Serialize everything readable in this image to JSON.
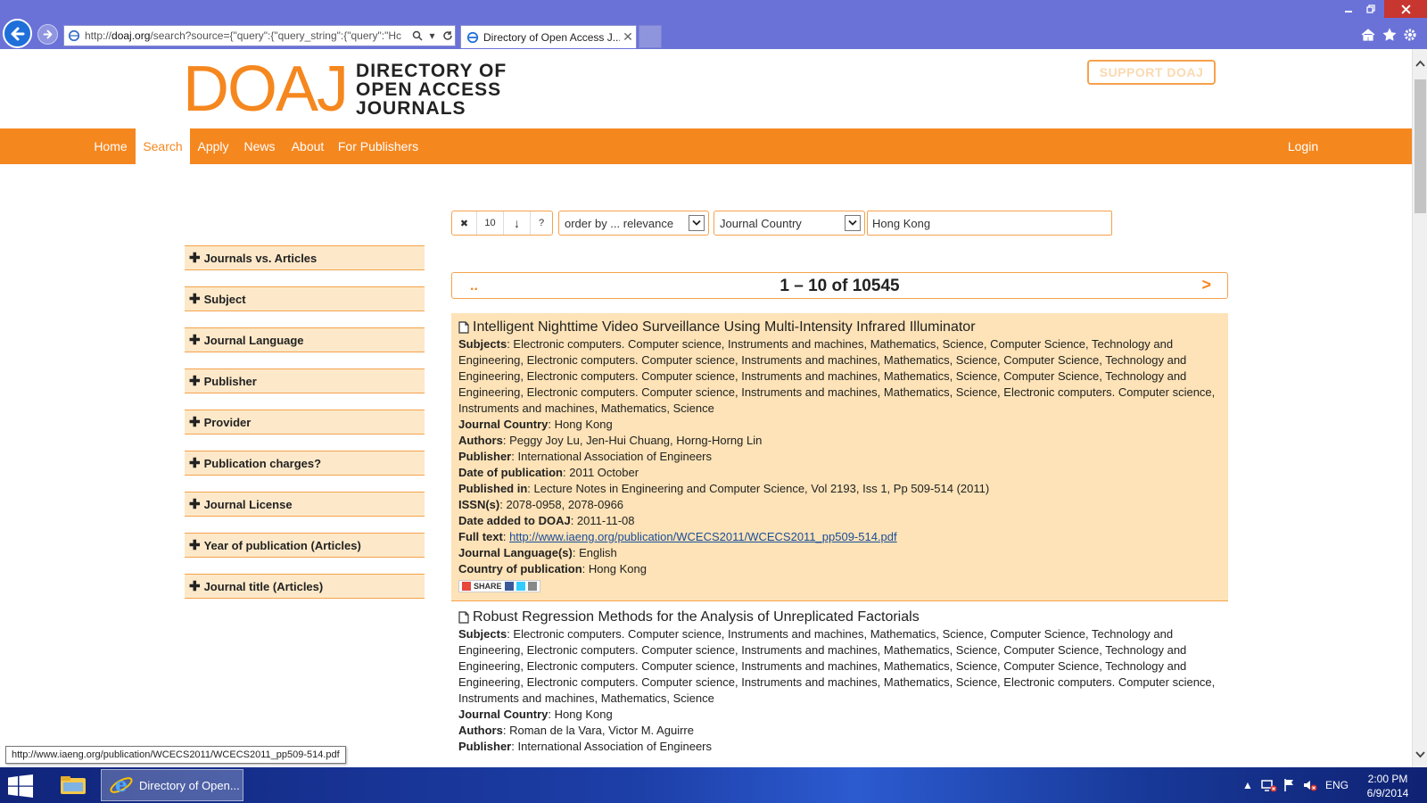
{
  "browser": {
    "address_host": "doaj.org",
    "address_prefix": "http://",
    "address_rest": "/search?source={\"query\":{\"query_string\":{\"query\":\"Hc",
    "tab_title": "Directory of Open Access J...",
    "tab_close": "✕"
  },
  "header": {
    "logo_mark": "DOAJ",
    "logo_line1": "DIRECTORY OF",
    "logo_line2": "OPEN ACCESS",
    "logo_line3": "JOURNALS",
    "support_label": "SUPPORT DOAJ"
  },
  "menu": {
    "items": [
      "Home",
      "Search",
      "Apply",
      "News",
      "About",
      "For Publishers"
    ],
    "active": "Search",
    "login": "Login"
  },
  "controls": {
    "clear": "✖",
    "page_size": "10",
    "sort_dir": "↓",
    "help": "?",
    "order_value": "order by ... relevance",
    "field_value": "Journal Country",
    "query_value": "Hong Kong"
  },
  "facets": [
    "Journals vs. Articles",
    "Subject",
    "Journal Language",
    "Publisher",
    "Provider",
    "Publication charges?",
    "Journal License",
    "Year of publication (Articles)",
    "Journal title (Articles)"
  ],
  "pager": {
    "prev": "..",
    "count": "1 – 10 of 10545",
    "next": ">"
  },
  "labels": {
    "subjects": "Subjects",
    "journal_country": "Journal Country",
    "authors": "Authors",
    "publisher": "Publisher",
    "date_pub": "Date of publication",
    "published_in": "Published in",
    "issn": "ISSN(s)",
    "date_added": "Date added to DOAJ",
    "full_text": "Full text",
    "journal_language": "Journal Language(s)",
    "country_pub": "Country of publication",
    "share": "SHARE"
  },
  "results": [
    {
      "title": "Intelligent Nighttime Video Surveillance Using Multi-Intensity Infrared Illuminator",
      "subjects": "Electronic computers. Computer science, Instruments and machines, Mathematics, Science, Computer Science, Technology and Engineering, Electronic computers. Computer science, Instruments and machines, Mathematics, Science, Computer Science, Technology and Engineering, Electronic computers. Computer science, Instruments and machines, Mathematics, Science, Computer Science, Technology and Engineering, Electronic computers. Computer science, Instruments and machines, Mathematics, Science, Electronic computers. Computer science, Instruments and machines, Mathematics, Science",
      "journal_country": "Hong Kong",
      "authors": "Peggy Joy Lu, Jen-Hui Chuang, Horng-Horng Lin",
      "publisher": "International Association of Engineers",
      "date_pub": "2011 October",
      "published_in": "Lecture Notes in Engineering and Computer Science, Vol 2193, Iss 1, Pp 509-514 (2011)",
      "issn": "2078-0958, 2078-0966",
      "date_added": "2011-11-08",
      "full_text": "http://www.iaeng.org/publication/WCECS2011/WCECS2011_pp509-514.pdf",
      "journal_language": "English",
      "country_pub": "Hong Kong"
    },
    {
      "title": "Robust Regression Methods for the Analysis of Unreplicated Factorials",
      "subjects": "Electronic computers. Computer science, Instruments and machines, Mathematics, Science, Computer Science, Technology and Engineering, Electronic computers. Computer science, Instruments and machines, Mathematics, Science, Computer Science, Technology and Engineering, Electronic computers. Computer science, Instruments and machines, Mathematics, Science, Computer Science, Technology and Engineering, Electronic computers. Computer science, Instruments and machines, Mathematics, Science, Electronic computers. Computer science, Instruments and machines, Mathematics, Science",
      "journal_country": "Hong Kong",
      "authors": "Roman de la Vara, Victor M. Aguirre",
      "publisher": "International Association of Engineers"
    }
  ],
  "status_tooltip": "http://www.iaeng.org/publication/WCECS2011/WCECS2011_pp509-514.pdf",
  "taskbar": {
    "ie_label": "Directory of Open...",
    "lang": "ENG",
    "time": "2:00 PM",
    "date": "6/9/2014"
  },
  "colors": {
    "accent": "#f5871f",
    "highlight": "#fde3b7",
    "facet_bg": "#fde9c9",
    "chrome": "#6a72d8"
  }
}
